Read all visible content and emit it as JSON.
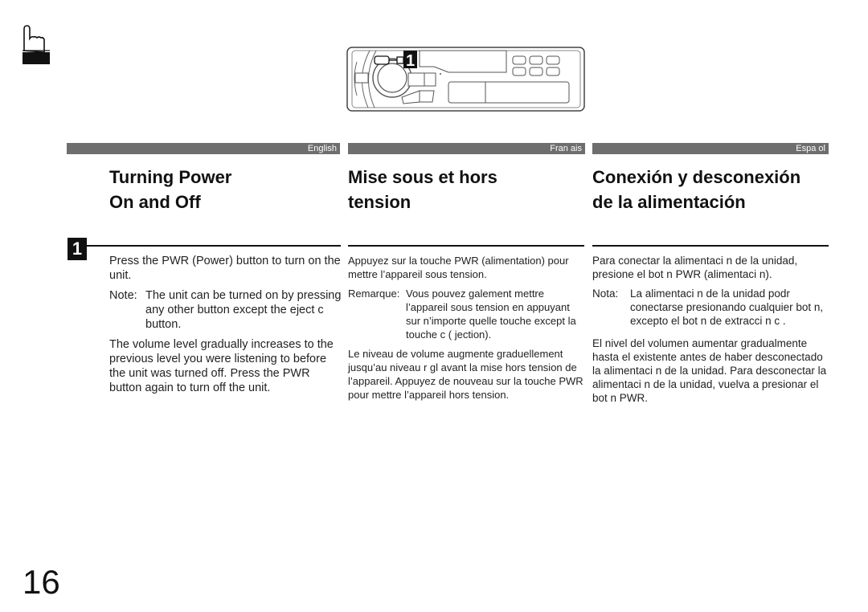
{
  "page": {
    "number": "16",
    "icon": "pointing-hand-icon"
  },
  "illustration": {
    "name": "car-stereo-faceplate",
    "callout": "1"
  },
  "columns": [
    {
      "language": "English",
      "title_line1": "Turning Power",
      "title_line2": "On and Off",
      "para1": "Press the PWR (Power) button to turn on the unit.",
      "note_label": "Note:",
      "note_text": "The unit can be turned on by pressing any other button except the eject c  button.",
      "para2": "The volume level gradually increases to the previous level you were listening to before the unit was turned off. Press the PWR button again to turn off the unit."
    },
    {
      "language": "Fran ais",
      "title_line1": "Mise sous et hors",
      "title_line2": "tension",
      "para1": "Appuyez sur la touche PWR (alimentation) pour mettre l’appareil sous tension.",
      "note_label": "Remarque:",
      "note_text": "Vous pouvez  galement mettre l’appareil sous tension en appuyant sur n’importe quelle touche except  la touche  c ( jection).",
      "para2": "Le niveau de volume augmente graduellement jusqu’au niveau r gl  avant la mise hors tension de l’appareil. Appuyez de nouveau sur la touche PWR pour mettre l’appareil hors tension."
    },
    {
      "language": "Espa ol",
      "title_line1": "Conexión y desconexión",
      "title_line2": "de la alimentación",
      "para1": "Para conectar la alimentaci n de la unidad, presione el bot n PWR (alimentaci n).",
      "note_label": "Nota:",
      "note_text": "La alimentaci n de la unidad podr  conectarse presionando cualquier bot n, excepto el bot n de extracci n  c .",
      "para2": "El nivel del volumen aumentar gradualmente hasta el existente antes de haber desconectado la alimentaci n de la unidad. Para desconectar la alimentaci n de la unidad, vuelva a presionar el bot n PWR."
    }
  ],
  "step": {
    "number": "1"
  },
  "colors": {
    "language_bar": "#6e6e6e",
    "text": "#1a1a1a"
  }
}
